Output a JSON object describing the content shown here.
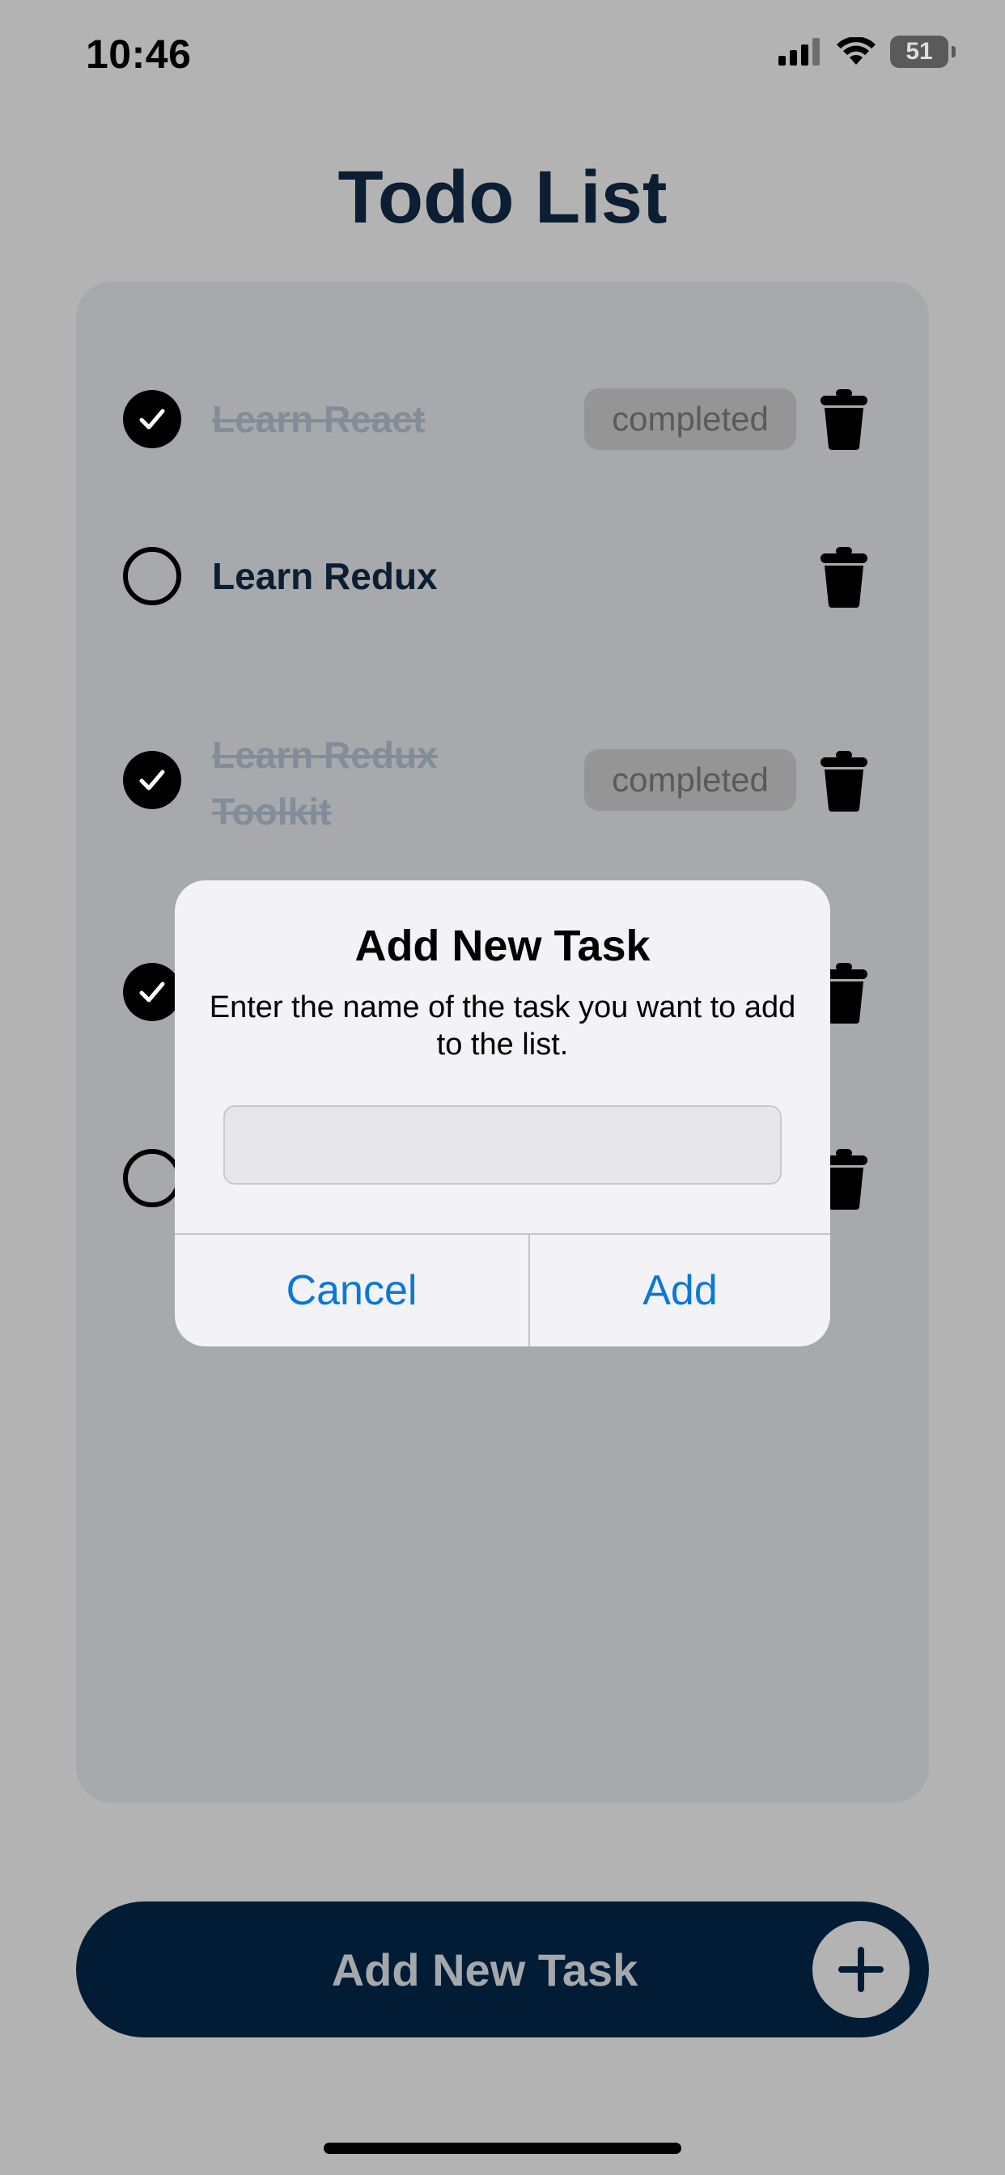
{
  "status_bar": {
    "time": "10:46",
    "battery": "51"
  },
  "app": {
    "title": "Todo List"
  },
  "tasks": [
    {
      "label": "Learn React",
      "completed": true,
      "badge": "completed"
    },
    {
      "label": "Learn Redux",
      "completed": false
    },
    {
      "label": "Learn Redux Toolkit",
      "completed": true,
      "badge": "completed"
    },
    {
      "label": "",
      "completed": true
    },
    {
      "label": "",
      "completed": false
    }
  ],
  "dialog": {
    "title": "Add New Task",
    "message": "Enter the name of the task you want to add to the list.",
    "input_value": "",
    "input_placeholder": "",
    "cancel_label": "Cancel",
    "add_label": "Add"
  },
  "footer": {
    "add_button_label": "Add New Task"
  },
  "colors": {
    "background": "#b3b3b3",
    "primary_navy": "#021c35",
    "title": "#0c1e33",
    "dialog_button": "#0a78d8",
    "completed_text": "#838c99"
  },
  "icons": [
    "signal-icon",
    "wifi-icon",
    "battery-icon",
    "checkmark-icon",
    "trash-icon",
    "plus-icon"
  ]
}
